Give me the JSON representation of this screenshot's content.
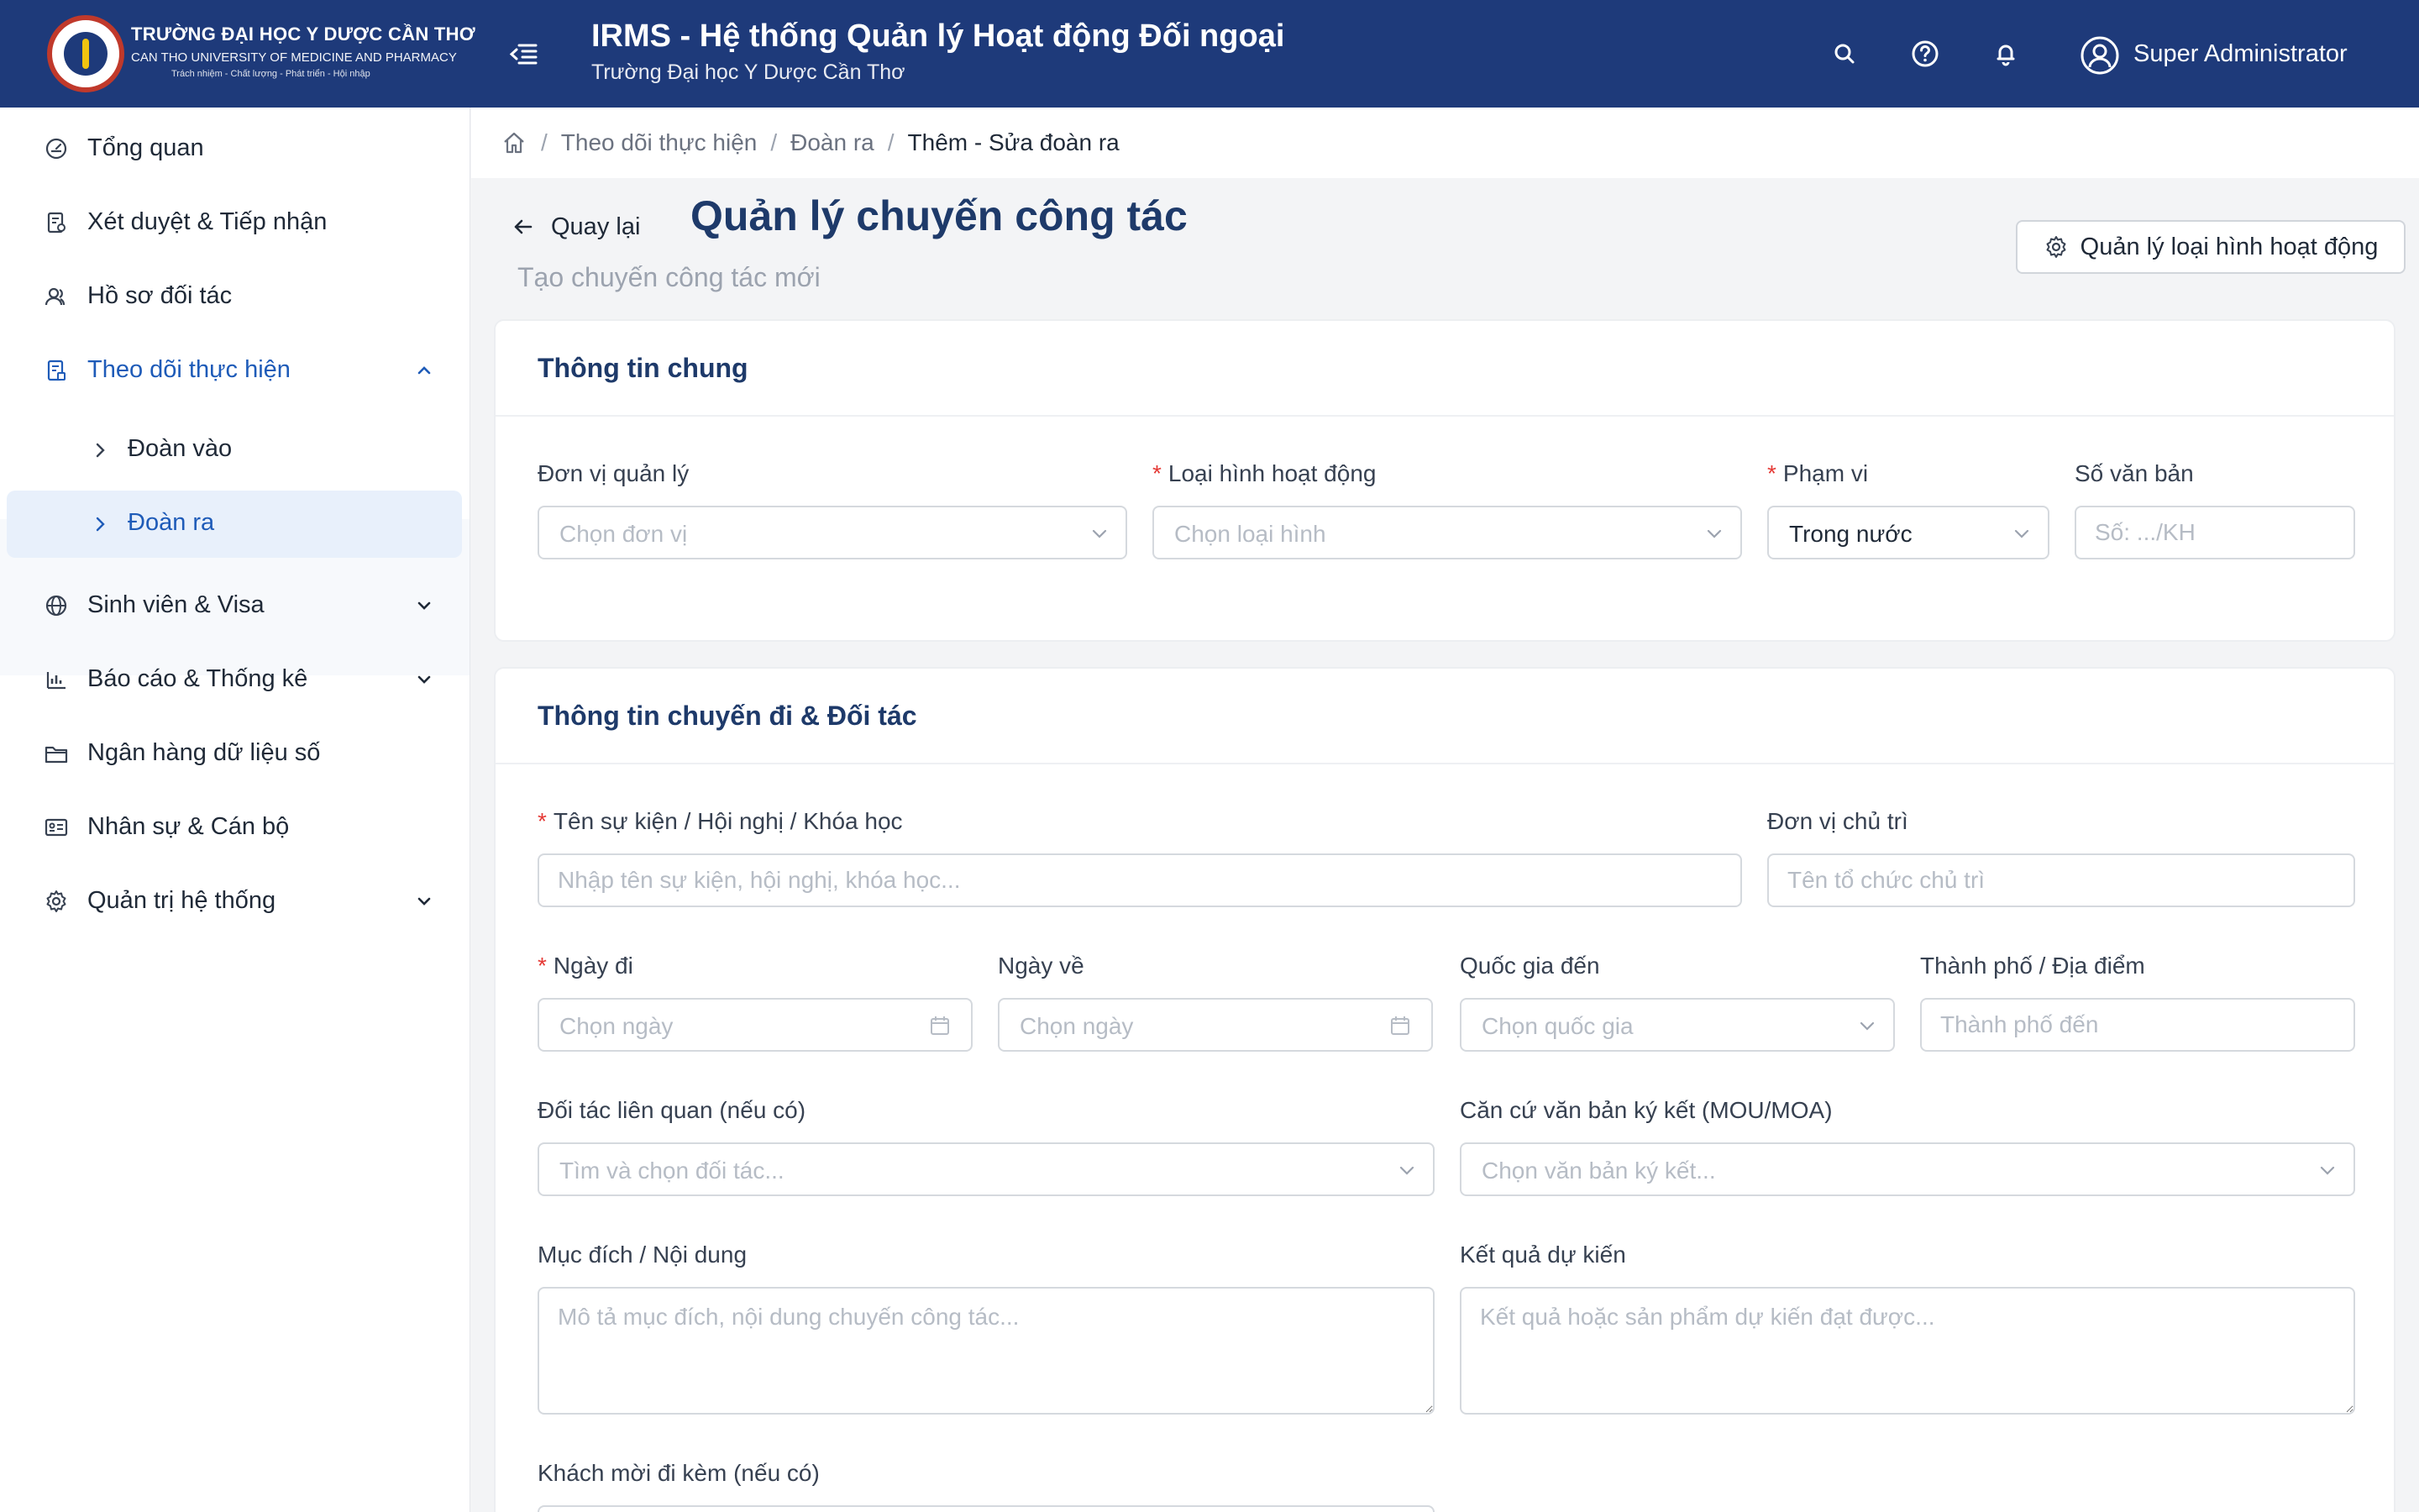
{
  "header": {
    "uni_name": "TRƯỜNG ĐẠI HỌC Y DƯỢC CẦN THƠ",
    "uni_en": "CAN THO UNIVERSITY OF MEDICINE AND PHARMACY",
    "uni_motto": "Trách nhiệm - Chất lượng - Phát triển - Hội nhập",
    "app_title": "IRMS - Hệ thống Quản lý Hoạt động Đối ngoại",
    "app_subtitle": "Trường Đại học Y Dược Cần Thơ",
    "user_name": "Super Administrator",
    "primary_color": "#1e3a7a",
    "accent_color": "#1e5bb8"
  },
  "sidebar": {
    "items": [
      {
        "label": "Tổng quan",
        "icon": "dashboard-icon"
      },
      {
        "label": "Xét duyệt & Tiếp nhận",
        "icon": "review-icon"
      },
      {
        "label": "Hồ sơ đối tác",
        "icon": "partners-icon"
      },
      {
        "label": "Theo dõi thực hiện",
        "icon": "tracking-icon"
      },
      {
        "label": "Sinh viên & Visa",
        "icon": "globe-icon"
      },
      {
        "label": "Báo cáo & Thống kê",
        "icon": "bar-chart-icon"
      },
      {
        "label": "Ngân hàng dữ liệu số",
        "icon": "folder-icon"
      },
      {
        "label": "Nhân sự & Cán bộ",
        "icon": "id-card-icon"
      },
      {
        "label": "Quản trị hệ thống",
        "icon": "gear-icon"
      }
    ],
    "sub_items": [
      {
        "label": "Đoàn vào"
      },
      {
        "label": "Đoàn ra"
      }
    ]
  },
  "breadcrumb": {
    "items": [
      "Theo dõi thực hiện",
      "Đoàn ra"
    ],
    "current": "Thêm - Sửa đoàn ra"
  },
  "page": {
    "back_label": "Quay lại",
    "title": "Quản lý chuyến công tác",
    "subtitle": "Tạo chuyến công tác mới",
    "manage_button": "Quản lý loại hình hoạt động"
  },
  "general": {
    "title": "Thông tin chung",
    "unit_label": "Đơn vị quản lý",
    "unit_placeholder": "Chọn đơn vị",
    "type_label": "Loại hình hoạt động",
    "type_placeholder": "Chọn loại hình",
    "scope_label": "Phạm vi",
    "scope_value": "Trong nước",
    "docno_label": "Số văn bản",
    "docno_placeholder": "Số: .../KH"
  },
  "trip": {
    "title": "Thông tin chuyến đi & Đối tác",
    "event_label": "Tên sự kiện / Hội nghị / Khóa học",
    "event_placeholder": "Nhập tên sự kiện, hội nghị, khóa học...",
    "host_label": "Đơn vị chủ trì",
    "host_placeholder": "Tên tổ chức chủ trì",
    "depart_label": "Ngày đi",
    "depart_placeholder": "Chọn ngày",
    "return_label": "Ngày về",
    "return_placeholder": "Chọn ngày",
    "country_label": "Quốc gia đến",
    "country_placeholder": "Chọn quốc gia",
    "city_label": "Thành phố / Địa điểm",
    "city_placeholder": "Thành phố đến",
    "partner_label": "Đối tác liên quan (nếu có)",
    "partner_placeholder": "Tìm và chọn đối tác...",
    "basis_label": "Căn cứ văn bản ký kết (MOU/MOA)",
    "basis_placeholder": "Chọn văn bản ký kết...",
    "purpose_label": "Mục đích / Nội dung",
    "purpose_placeholder": "Mô tả mục đích, nội dung chuyến công tác...",
    "result_label": "Kết quả dự kiến",
    "result_placeholder": "Kết quả hoặc sản phẩm dự kiến đạt được...",
    "guests_label": "Khách mời đi kèm (nếu có)"
  }
}
